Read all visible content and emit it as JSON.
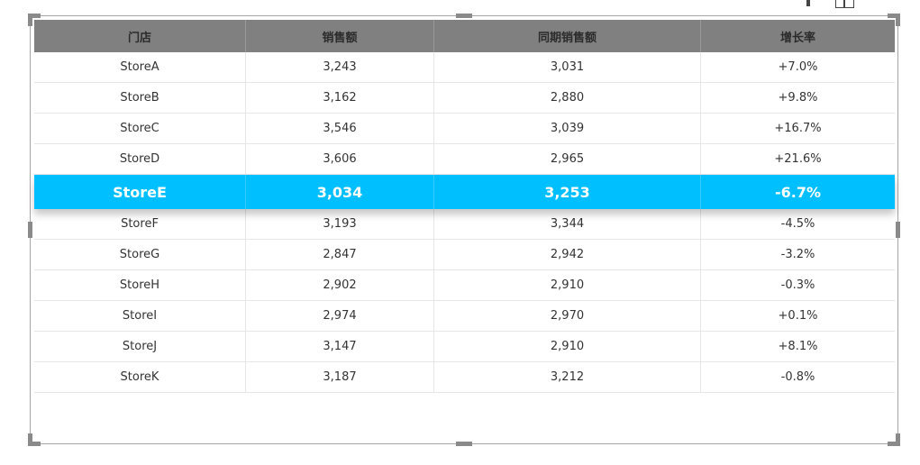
{
  "table": {
    "columns": [
      "门店",
      "销售额",
      "同期销售额",
      "增长率"
    ],
    "rows": [
      {
        "store": "StoreA",
        "sales": "3,243",
        "prior_sales": "3,031",
        "growth": "+7.0%"
      },
      {
        "store": "StoreB",
        "sales": "3,162",
        "prior_sales": "2,880",
        "growth": "+9.8%"
      },
      {
        "store": "StoreC",
        "sales": "3,546",
        "prior_sales": "3,039",
        "growth": "+16.7%"
      },
      {
        "store": "StoreD",
        "sales": "3,606",
        "prior_sales": "2,965",
        "growth": "+21.6%"
      },
      {
        "store": "StoreE",
        "sales": "3,034",
        "prior_sales": "3,253",
        "growth": "-6.7%"
      },
      {
        "store": "StoreF",
        "sales": "3,193",
        "prior_sales": "3,344",
        "growth": "-4.5%"
      },
      {
        "store": "StoreG",
        "sales": "2,847",
        "prior_sales": "2,942",
        "growth": "-3.2%"
      },
      {
        "store": "StoreH",
        "sales": "2,902",
        "prior_sales": "2,910",
        "growth": "-0.3%"
      },
      {
        "store": "StoreI",
        "sales": "2,974",
        "prior_sales": "2,970",
        "growth": "+0.1%"
      },
      {
        "store": "StoreJ",
        "sales": "3,147",
        "prior_sales": "2,910",
        "growth": "+8.1%"
      },
      {
        "store": "StoreK",
        "sales": "3,187",
        "prior_sales": "3,212",
        "growth": "-0.8%"
      }
    ]
  },
  "colors": {
    "header_background": "#808080",
    "highlight_background": "#00bfff",
    "highlight_text": "#ffffff"
  },
  "icons": {
    "toolbar": [
      "pin-icon",
      "focus-mode-icon"
    ]
  }
}
